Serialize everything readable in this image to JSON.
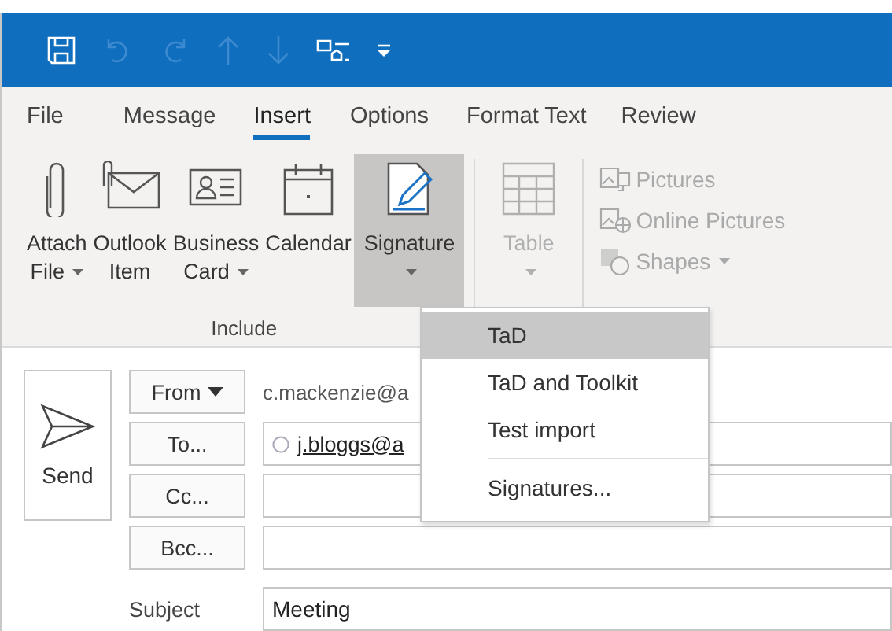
{
  "quick_access": [
    {
      "kind": "save",
      "disabled": false
    },
    {
      "kind": "undo",
      "disabled": true
    },
    {
      "kind": "redo",
      "disabled": true
    },
    {
      "kind": "up",
      "disabled": true
    },
    {
      "kind": "down",
      "disabled": true
    },
    {
      "kind": "shapes",
      "disabled": false
    },
    {
      "kind": "customize",
      "disabled": false
    }
  ],
  "tabs": [
    {
      "label": "File",
      "selected": false
    },
    {
      "label": "Message",
      "selected": false
    },
    {
      "label": "Insert",
      "selected": true
    },
    {
      "label": "Options",
      "selected": false
    },
    {
      "label": "Format Text",
      "selected": false
    },
    {
      "label": "Review",
      "selected": false
    }
  ],
  "ribbon": {
    "include": {
      "label": "Include",
      "buttons": [
        {
          "kind": "attach",
          "line1": "Attach",
          "line2": "File",
          "dropdown": true,
          "active": false
        },
        {
          "kind": "outlook-item",
          "line1": "Outlook",
          "line2": "Item",
          "dropdown": false,
          "active": false
        },
        {
          "kind": "business-card",
          "line1": "Business",
          "line2": "Card",
          "dropdown": true,
          "active": false
        },
        {
          "kind": "calendar",
          "line1": "Calendar",
          "dropdown": false,
          "active": false
        },
        {
          "kind": "signature",
          "line1": "Signature",
          "dropdown": true,
          "active": true
        }
      ]
    },
    "table": {
      "label": "Table",
      "disabled": true
    },
    "illustrations": [
      {
        "kind": "pictures",
        "label": "Pictures",
        "dropdown": false,
        "disabled": true
      },
      {
        "kind": "online-pictures",
        "label": "Online Pictures",
        "dropdown": false,
        "disabled": true
      },
      {
        "kind": "shapes",
        "label": "Shapes",
        "dropdown": true,
        "disabled": true
      }
    ]
  },
  "signature_menu": [
    {
      "label": "TaD",
      "selected": true,
      "separator_before": false
    },
    {
      "label": "TaD and Toolkit",
      "selected": false,
      "separator_before": false
    },
    {
      "label": "Test import",
      "selected": false,
      "separator_before": false
    },
    {
      "label": "Signatures...",
      "selected": false,
      "separator_before": true
    }
  ],
  "compose": {
    "send": "Send",
    "from": {
      "label": "From",
      "value": "c.mackenzie@a"
    },
    "to": {
      "label": "To...",
      "recipient": "j.bloggs@a"
    },
    "cc": {
      "label": "Cc..."
    },
    "bcc": {
      "label": "Bcc..."
    },
    "subject": {
      "label": "Subject",
      "value": "Meeting"
    }
  }
}
